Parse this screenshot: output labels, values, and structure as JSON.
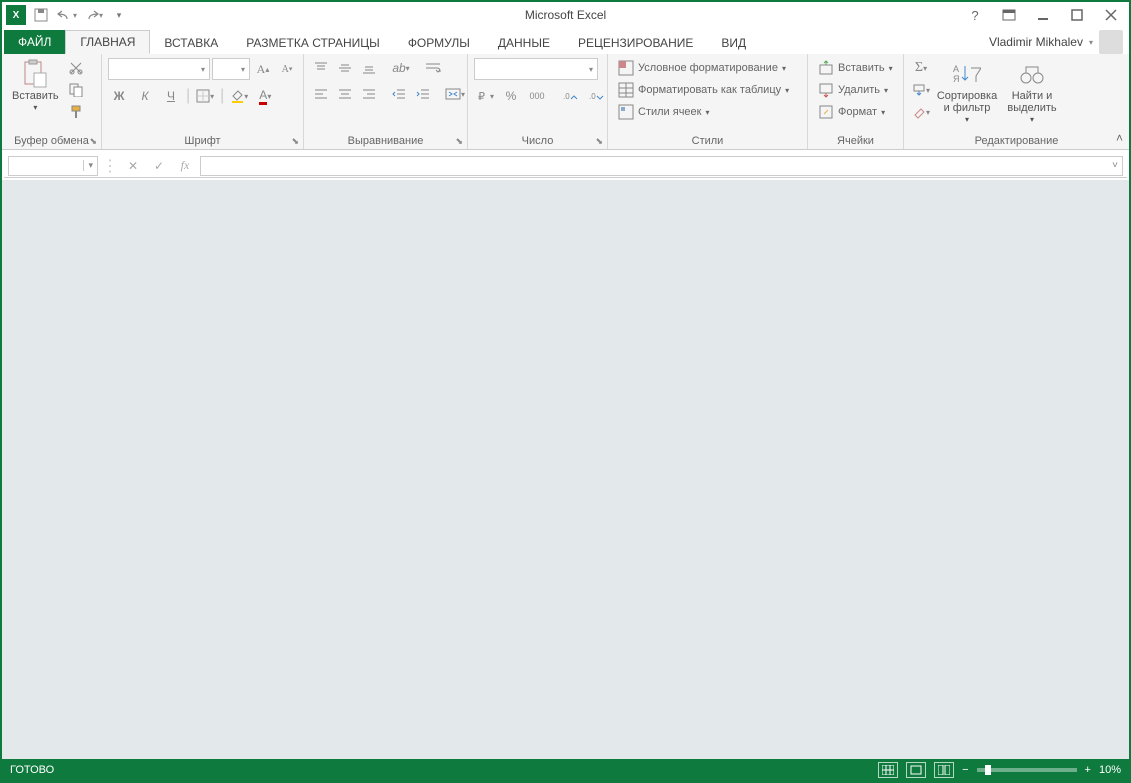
{
  "title": "Microsoft Excel",
  "user": {
    "name": "Vladimir Mikhalev"
  },
  "tabs": {
    "file": "ФАЙЛ",
    "items": [
      "ГЛАВНАЯ",
      "ВСТАВКА",
      "РАЗМЕТКА СТРАНИЦЫ",
      "ФОРМУЛЫ",
      "ДАННЫЕ",
      "РЕЦЕНЗИРОВАНИЕ",
      "ВИД"
    ],
    "active": 0
  },
  "ribbon": {
    "clipboard": {
      "label": "Буфер обмена",
      "paste": "Вставить"
    },
    "font": {
      "label": "Шрифт",
      "bold": "Ж",
      "italic": "К",
      "underline": "Ч"
    },
    "alignment": {
      "label": "Выравнивание"
    },
    "number": {
      "label": "Число",
      "percent": "%",
      "thousands": "000"
    },
    "styles": {
      "label": "Стили",
      "cond": "Условное форматирование",
      "table": "Форматировать как таблицу",
      "cell": "Стили ячеек"
    },
    "cells": {
      "label": "Ячейки",
      "insert": "Вставить",
      "delete": "Удалить",
      "format": "Формат"
    },
    "editing": {
      "label": "Редактирование",
      "sort": "Сортировка и фильтр",
      "find": "Найти и выделить"
    }
  },
  "status": {
    "ready": "ГОТОВО",
    "zoom": "10%"
  }
}
